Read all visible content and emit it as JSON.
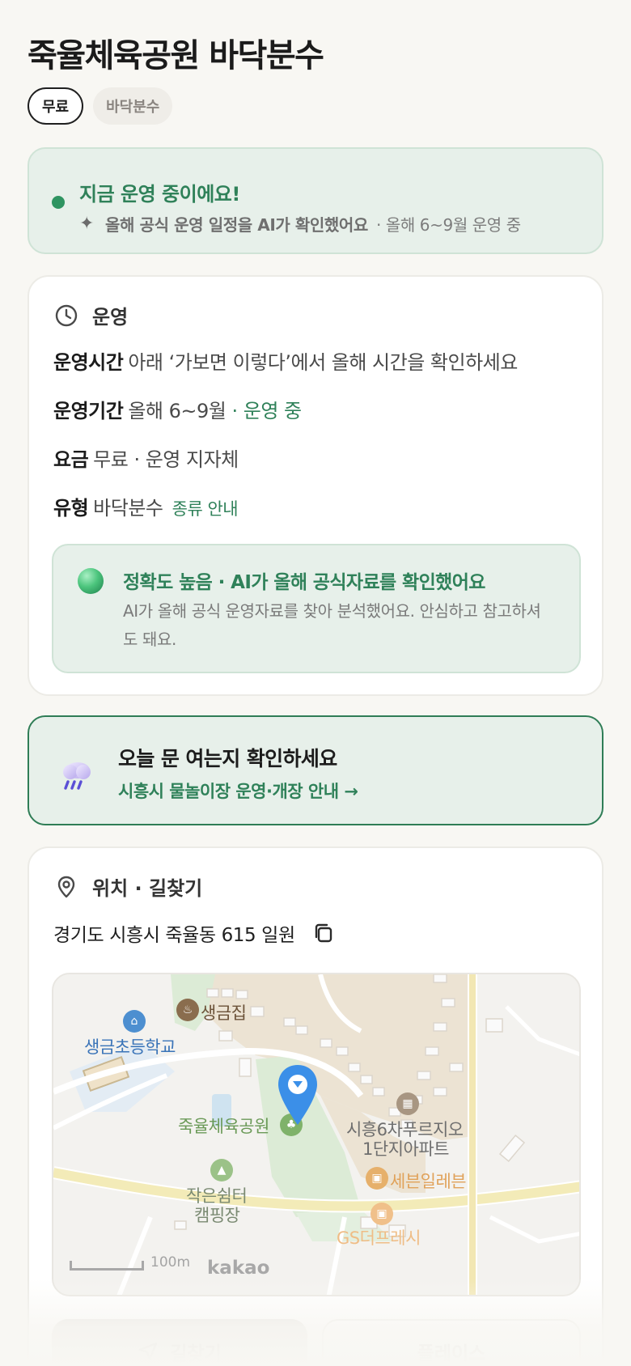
{
  "title": "죽율체육공원 바닥분수",
  "chips": [
    {
      "label": "무료"
    },
    {
      "label": "바닥분수"
    }
  ],
  "status": {
    "title": "지금 운영 중이에요!",
    "sub_bold": "올해 공식 운영 일정을 AI가 확인했어요",
    "sub_rest": "· 올해 6~9월 운영 중"
  },
  "operation": {
    "heading": "운영",
    "rows": [
      {
        "key": "운영시간",
        "value": "아래 ‘가보면 이렇다’에서 올해 시간을 확인하세요"
      },
      {
        "key": "운영기간",
        "value": "올해 6~9월",
        "accent": "· 운영 중"
      },
      {
        "key": "요금",
        "value": "무료 · 운영 지자체"
      },
      {
        "key": "유형",
        "value": "바닥분수",
        "link": "종류 안내"
      }
    ],
    "accuracy": {
      "title": "정확도 높음 · AI가 올해 공식자료를 확인했어요",
      "desc": "AI가 올해 공식 운영자료를 찾아 분석했어요. 안심하고 참고하셔도 돼요."
    }
  },
  "notice": {
    "title": "오늘 문 여는지 확인하세요",
    "link": "시흥시 물놀이장 운영·개장 안내 →"
  },
  "location": {
    "heading": "위치 · 길찾기",
    "address": "경기도 시흥시 죽율동 615 일원",
    "map": {
      "labels": {
        "school": "생금초등학교",
        "restaurant": "생금집",
        "park": "죽율체육공원",
        "apartment_line1": "시흥6차푸르지오",
        "apartment_line2": "1단지아파트",
        "store1": "세븐일레븐",
        "camp_line1": "작은쉼터",
        "camp_line2": "캠핑장",
        "store2": "GS더프레시"
      },
      "scale": "100m",
      "provider": "kakao"
    },
    "buttons": {
      "directions": "길찾기",
      "place": "플레이스"
    }
  },
  "colors": {
    "accent_green": "#2f8159",
    "status_bg": "#e7f0ea",
    "page_bg": "#f8f7f3",
    "pin_blue": "#3b8fe8"
  }
}
